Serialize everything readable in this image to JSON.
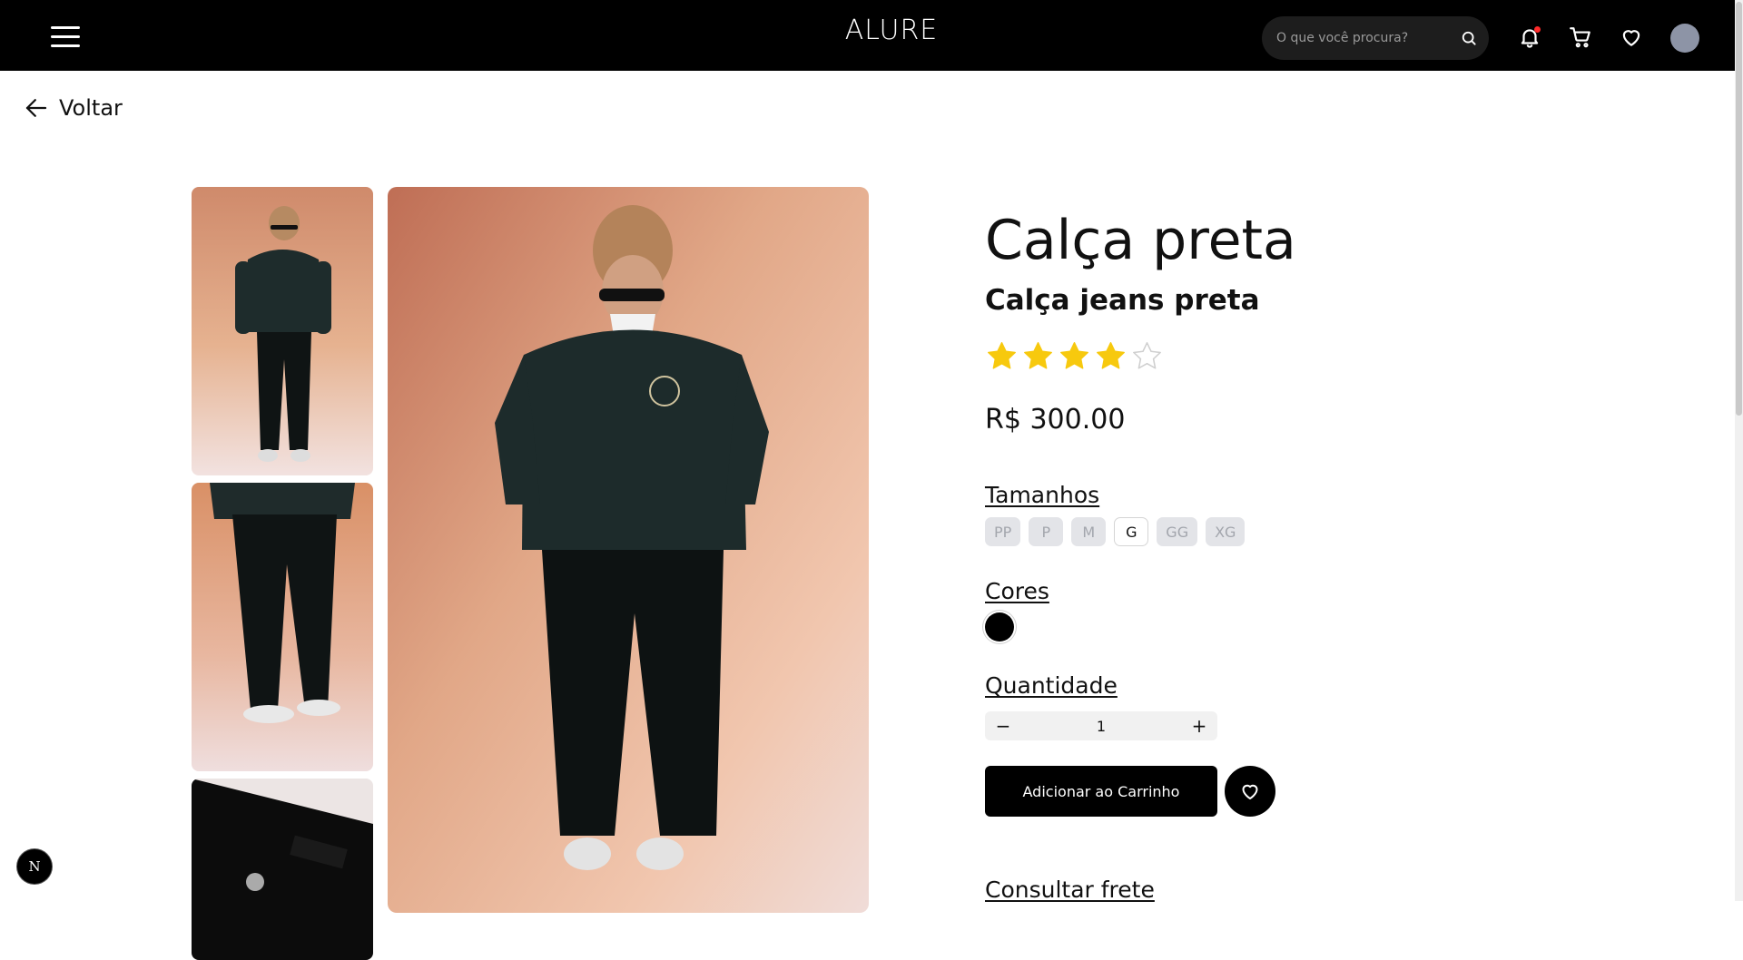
{
  "header": {
    "brand": "ALURE",
    "search_placeholder": "O que você procura?"
  },
  "nav": {
    "back_label": "Voltar"
  },
  "product": {
    "title": "Calça preta",
    "subtitle": "Calça jeans preta",
    "rating": 4,
    "rating_max": 5,
    "price": "R$ 300.00"
  },
  "sizes": {
    "title": "Tamanhos",
    "options": [
      "PP",
      "P",
      "M",
      "G",
      "GG",
      "XG"
    ],
    "selected": "G"
  },
  "colors": {
    "title": "Cores",
    "options": [
      "#000000"
    ]
  },
  "quantity": {
    "title": "Quantidade",
    "minus": "−",
    "value": "1",
    "plus": "+"
  },
  "actions": {
    "add_to_cart": "Adicionar ao Carrinho"
  },
  "shipping": {
    "link": "Consultar frete"
  },
  "dev_badge": "N",
  "colors_theme": {
    "header_bg": "#000000",
    "star": "#f7c90e",
    "notification_dot": "#ff2a2a"
  }
}
